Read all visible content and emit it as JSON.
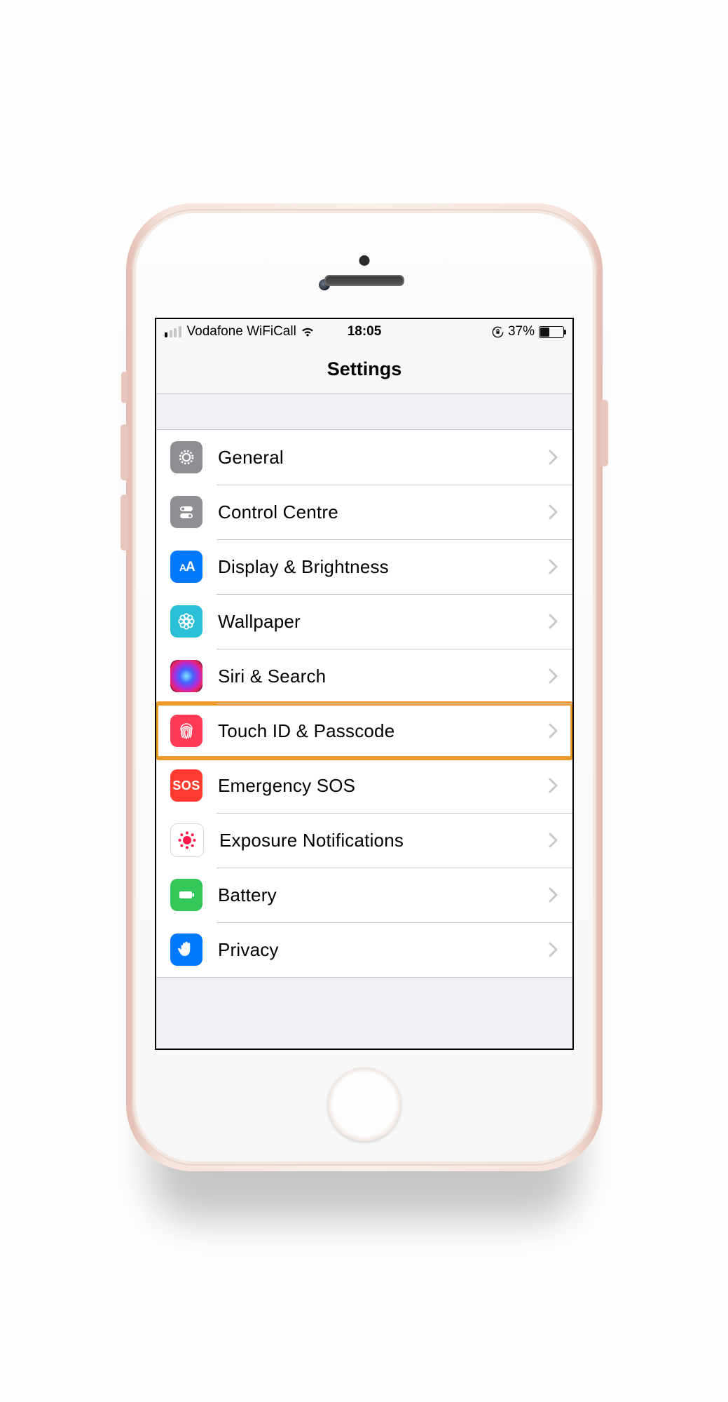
{
  "status": {
    "carrier": "Vodafone WiFiCall",
    "time": "18:05",
    "battery_pct": "37%"
  },
  "nav": {
    "title": "Settings"
  },
  "rows": {
    "general": {
      "label": "General"
    },
    "control": {
      "label": "Control Centre"
    },
    "display": {
      "label": "Display & Brightness"
    },
    "wallpaper": {
      "label": "Wallpaper"
    },
    "siri": {
      "label": "Siri & Search"
    },
    "touchid": {
      "label": "Touch ID & Passcode"
    },
    "sos": {
      "label": "Emergency SOS",
      "icon_text": "SOS"
    },
    "exposure": {
      "label": "Exposure Notifications"
    },
    "battery": {
      "label": "Battery"
    },
    "privacy": {
      "label": "Privacy"
    }
  }
}
